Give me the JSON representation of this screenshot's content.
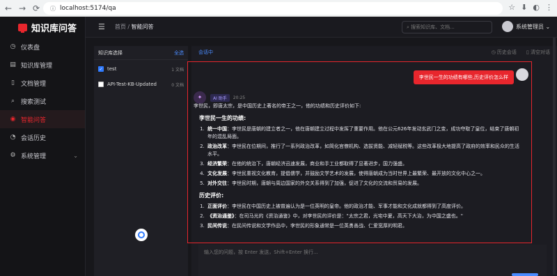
{
  "browser": {
    "url": "localhost:5174/qa",
    "back": "←",
    "forward": "→",
    "reload": "⟳",
    "info": "ⓘ",
    "icons": [
      "☆",
      "⬇",
      "◐",
      "⋮"
    ]
  },
  "logo": {
    "title": "知识库问答"
  },
  "sidebar": {
    "items": [
      {
        "label": "仪表盘",
        "icon": "◷"
      },
      {
        "label": "知识库管理",
        "icon": "▤"
      },
      {
        "label": "文档管理",
        "icon": "▯"
      },
      {
        "label": "搜索测试",
        "icon": "⌕"
      },
      {
        "label": "智能问答",
        "icon": "◉"
      },
      {
        "label": "会话历史",
        "icon": "◔"
      },
      {
        "label": "系统管理",
        "icon": "⚙",
        "chevron": "⌄"
      }
    ]
  },
  "topbar": {
    "menu_icon": "☰",
    "breadcrumb_home": "首页",
    "breadcrumb_sep": " / ",
    "breadcrumb_current": "智能问答",
    "search_placeholder": "⌕ 搜索知识库、文档...",
    "user": "系统管理员 ⌄"
  },
  "kb": {
    "title": "知识库选择",
    "select_all": "全选",
    "items": [
      {
        "name": "test",
        "count": "1 文档",
        "checked": "✓"
      },
      {
        "name": "API-Test-KB-Updated",
        "count": "0 文档",
        "checked": ""
      }
    ]
  },
  "chat": {
    "status": "会话中",
    "history": "◷ 历史会话",
    "clear": "▯ 清空对话",
    "user_question": "李世民一生的功绩有哪些,历史评价怎么样",
    "ai_avatar": "✦",
    "ai_name": "AI 助手",
    "ai_time": "20:25",
    "intro": "李世民，即唐太宗，是中国历史上著名的帝王之一，他的功绩和历史评价如下:",
    "section1": "李世民一生的功绩:",
    "achievements": [
      {
        "title": "统一中国",
        "text": "：李世民是唐朝的建立者之一，他在唐朝建立过程中发挥了重要作用。他在公元626年发动玄武门之变，成功夺取了皇位，结束了唐朝初年的混乱局面。"
      },
      {
        "title": "政治改革",
        "text": "：李世民在位期间，推行了一系列政治改革，如简化官僚机构、选拔贤能、减轻赋税等。这些改革极大地提高了政府的效率和民众的生活水平。"
      },
      {
        "title": "经济繁荣",
        "text": "：在他的统治下，唐朝经济迅速发展，商业和手工业都取得了显著进步，国力强盛。"
      },
      {
        "title": "文化发展",
        "text": "：李世民重视文化教育，提倡儒学，并鼓励文学艺术的发展，使得唐朝成为当时世界上最繁荣、最开放的文化中心之一。"
      },
      {
        "title": "对外交往",
        "text": "：李世民时期，唐朝与周边国家的外交关系得到了加强，促进了文化的交流和贸易的发展。"
      }
    ],
    "section2": "历史评价:",
    "evaluations": [
      {
        "title": "正面评价",
        "text": "：李世民在中国历史上被普遍认为是一位英明的皇帝。他的政治才能、军事才能和文化成就都得到了高度评价。"
      },
      {
        "title": "《资治通鉴》",
        "text": "：在司马光的《资治通鉴》中，对李世民的评价是：\"太宗之君，光宅中夏，高天下大治，为中国之盛也。\""
      },
      {
        "title": "民间传说",
        "text": "：在民间传说和文学作品中，李世民的形象通常是一位英勇善战、仁爱宽厚的明君。"
      }
    ],
    "input_placeholder": "输入您的问题，按 Enter 发送，Shift+Enter 换行..."
  }
}
